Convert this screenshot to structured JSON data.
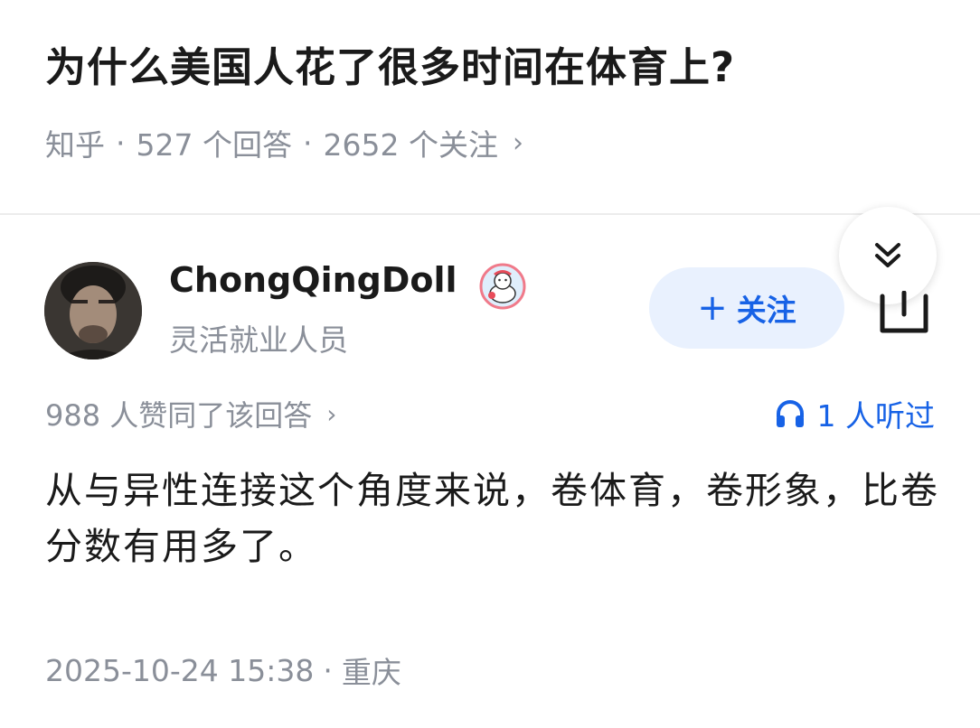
{
  "question": {
    "title": "为什么美国人花了很多时间在体育上?",
    "source": "知乎",
    "answers": "527 个回答",
    "followers": "2652 个关注",
    "separator": "·",
    "chevron": "›"
  },
  "collapse_button": {
    "icon": "double-chevron-down-icon"
  },
  "author": {
    "name": "ChongQingDoll",
    "bio": "灵活就业人员",
    "badge_icon": "cartoon-badge-icon",
    "avatar_icon": "user-avatar"
  },
  "follow_button": {
    "plus": "+",
    "label": "关注"
  },
  "share_button": {
    "icon": "share-icon"
  },
  "answer": {
    "upvotes": "988 人赞同了该回答",
    "upvotes_chevron": "›",
    "listeners": "1 人听过",
    "listen_icon": "headphones-icon",
    "content": "从与异性连接这个角度来说，卷体育，卷形象，比卷分数有用多了。",
    "date": "2025-10-24 15:38",
    "separator": "·",
    "location": "重庆"
  },
  "colors": {
    "accent": "#1762e6",
    "follow_bg": "#e9f1fe",
    "meta_gray": "#8a8f99",
    "text": "#1a1a1a"
  }
}
